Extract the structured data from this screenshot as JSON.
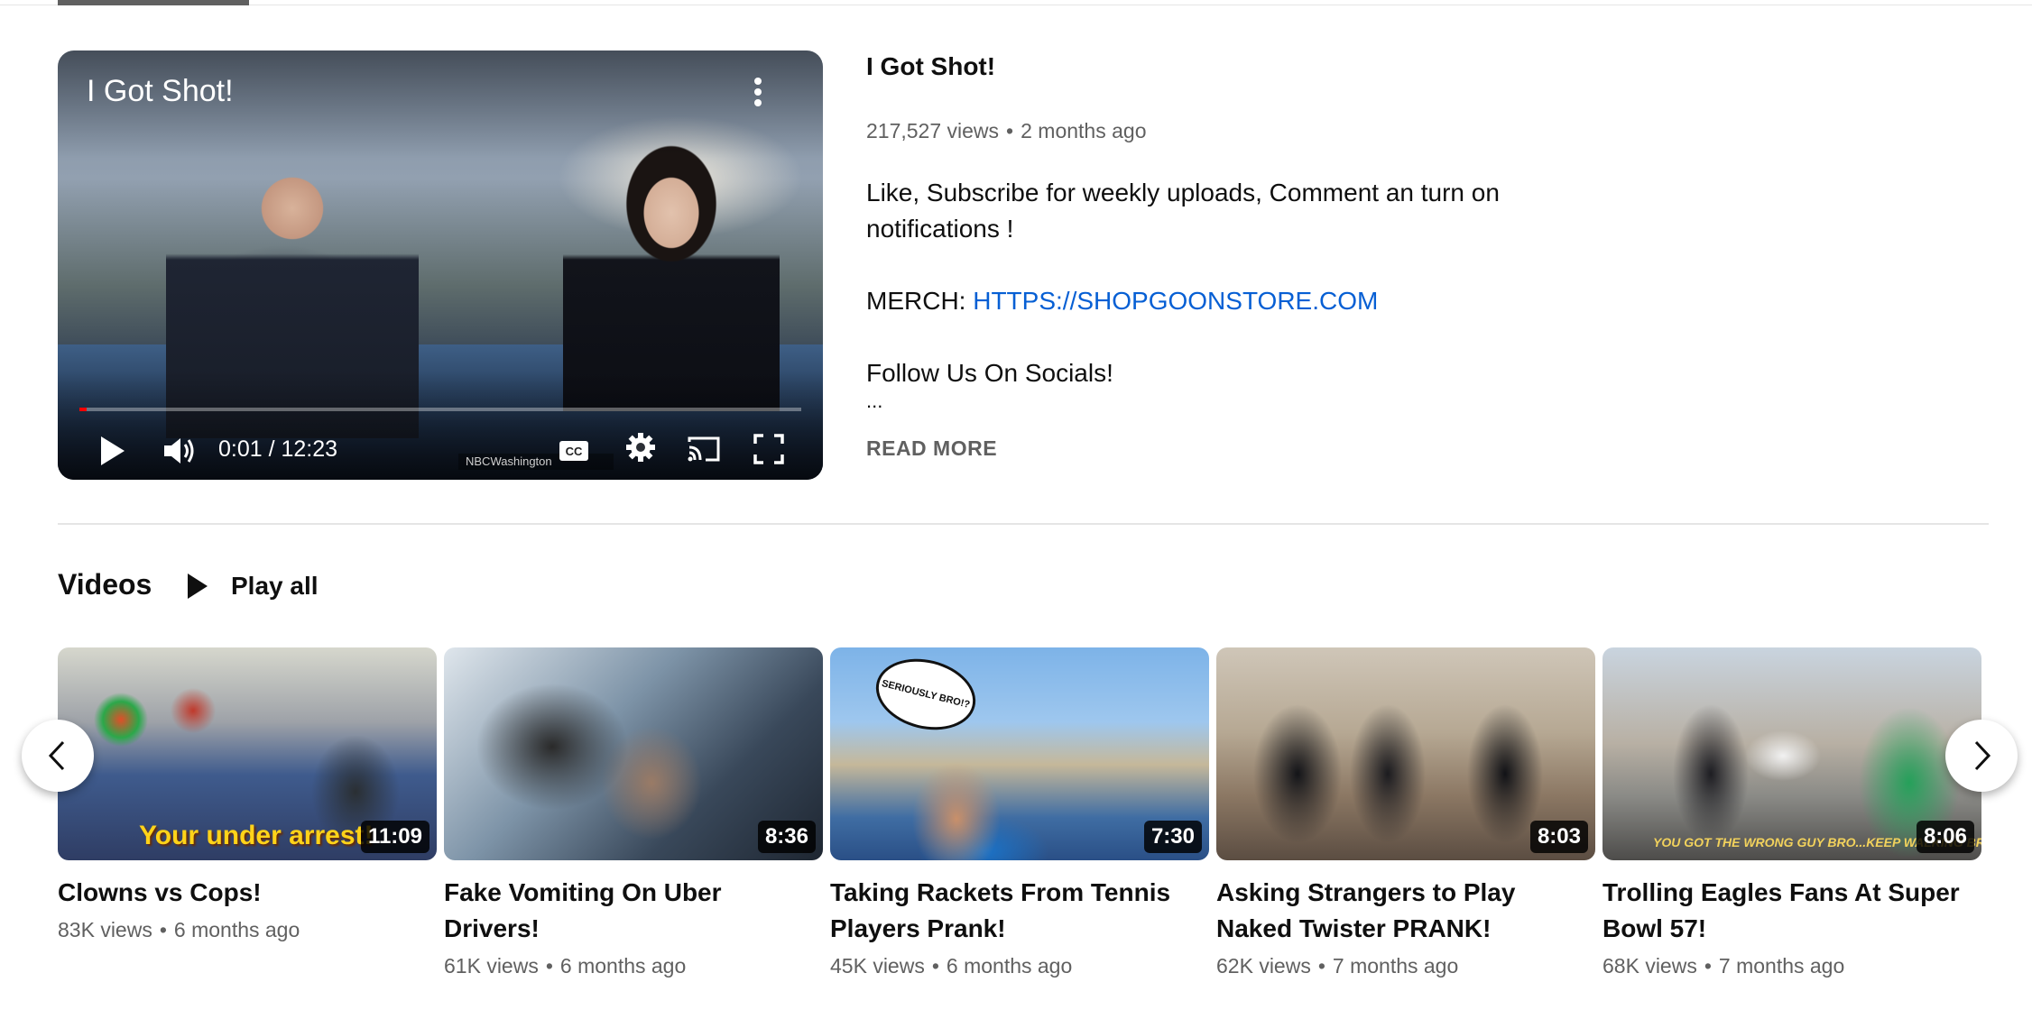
{
  "featured": {
    "player_title": "I Got Shot!",
    "time_readout": "0:01 / 12:23",
    "progress": 0.001,
    "watermark": "NBCWashington",
    "title": "I Got Shot!",
    "views": "217,527 views",
    "separator": "•",
    "age": "2 months ago",
    "description": {
      "line1": "Like, Subscribe for weekly uploads, Comment an turn on",
      "line2": "notifications !",
      "merch_label": "MERCH: ",
      "merch_link": "HTTPS://SHOPGOONSTORE.COM",
      "socials": "Follow Us On Socials!",
      "ellipsis": "..."
    },
    "read_more": "READ MORE"
  },
  "shelf": {
    "title": "Videos",
    "play_all": "Play all"
  },
  "videos": [
    {
      "title": "Clowns vs Cops!",
      "views": "83K views",
      "age": "6 months ago",
      "duration": "11:09",
      "overlay": "Your under arrest!"
    },
    {
      "title": "Fake Vomiting On Uber Drivers!",
      "views": "61K views",
      "age": "6 months ago",
      "duration": "8:36"
    },
    {
      "title": "Taking Rackets From Tennis Players Prank!",
      "views": "45K views",
      "age": "6 months ago",
      "duration": "7:30",
      "bubble": "SERIOUSLY BRO!?"
    },
    {
      "title": "Asking Strangers to Play Naked Twister PRANK!",
      "views": "62K views",
      "age": "7 months ago",
      "duration": "8:03"
    },
    {
      "title": "Trolling Eagles Fans At Super Bowl 57!",
      "views": "68K views",
      "age": "7 months ago",
      "duration": "8:06",
      "overlay": "YOU GOT THE WRONG GUY BRO...KEEP WALKING BRO"
    }
  ],
  "colors": {
    "link": "#065fd4",
    "secondary_text": "#606060",
    "progress": "#ff0000"
  },
  "icons": [
    "more-vert-icon",
    "play-icon",
    "volume-icon",
    "cc-icon",
    "settings-icon",
    "cast-icon",
    "fullscreen-icon",
    "chevron-left-icon",
    "chevron-right-icon"
  ]
}
